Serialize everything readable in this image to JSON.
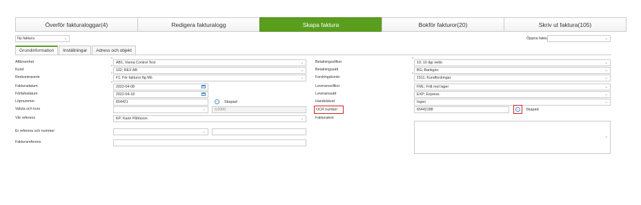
{
  "toolbar": {
    "buttons": [
      {
        "label": "Överför fakturaloggar(4)"
      },
      {
        "label": "Redigera fakturalogg"
      },
      {
        "label": "Skapa faktura"
      },
      {
        "label": "Bokför fakturor(20)"
      },
      {
        "label": "Skriv ut faktura(105)"
      }
    ]
  },
  "invoice_type": {
    "value": "Ny faktura"
  },
  "open_invoice": {
    "label": "Öppna faktura",
    "value": ""
  },
  "tabs": [
    {
      "label": "Grundinformation"
    },
    {
      "label": "Inställningar"
    },
    {
      "label": "Adress och objekt"
    }
  ],
  "left": {
    "affarsenhet": {
      "label": "Affärsenhet",
      "value": "AB1; Visma Control Test"
    },
    "kund": {
      "label": "Kund",
      "value": "102; REX AB"
    },
    "reskontraserie": {
      "label": "Reskontraserie",
      "value": "F1; För fakturor ftg Mö"
    },
    "fakturadatum": {
      "label": "Fakturadatum",
      "value": "2022-04-08"
    },
    "forfallodatum": {
      "label": "Förfallodatum",
      "value": "2022-04-18"
    },
    "lopnummer": {
      "label": "Löpnummer",
      "value": "654421",
      "status": "Skapad"
    },
    "valuta": {
      "label": "Valuta och kurs",
      "value": "",
      "rate": "0,0000"
    },
    "var_referens": {
      "label": "Vår referens",
      "value": "KP; Karin Påhlsson"
    },
    "er_referens": {
      "label": "Er referens och nummer",
      "value": "",
      "number": ""
    },
    "fakturareferens": {
      "label": "Fakturareferens",
      "value": ""
    }
  },
  "right": {
    "betalningsvillkor": {
      "label": "Betalningsvillkor",
      "value": "10; 10 dgr netto"
    },
    "betalningssatt": {
      "label": "Betalningssätt",
      "value": "BG; Bankgiro"
    },
    "fordringskonto": {
      "label": "Fordringskonto",
      "value": "1511; Kundfordringar"
    },
    "leveransvillkor": {
      "label": "Leveransvillkor",
      "value": "FML; Fritt mot lager"
    },
    "leveranssatt": {
      "label": "Leveranssätt",
      "value": "EXP; Express"
    },
    "handelskod": {
      "label": "Handelskod",
      "value": "Ingen"
    },
    "ocr": {
      "label": "OCR number",
      "value": "65442188",
      "status": "Skapad"
    },
    "fakturatext": {
      "label": "Fakturatext",
      "value": ""
    }
  },
  "colors": {
    "accent": "#5a9e1e",
    "highlight": "#d21f1f",
    "link": "#4a8ac9"
  }
}
